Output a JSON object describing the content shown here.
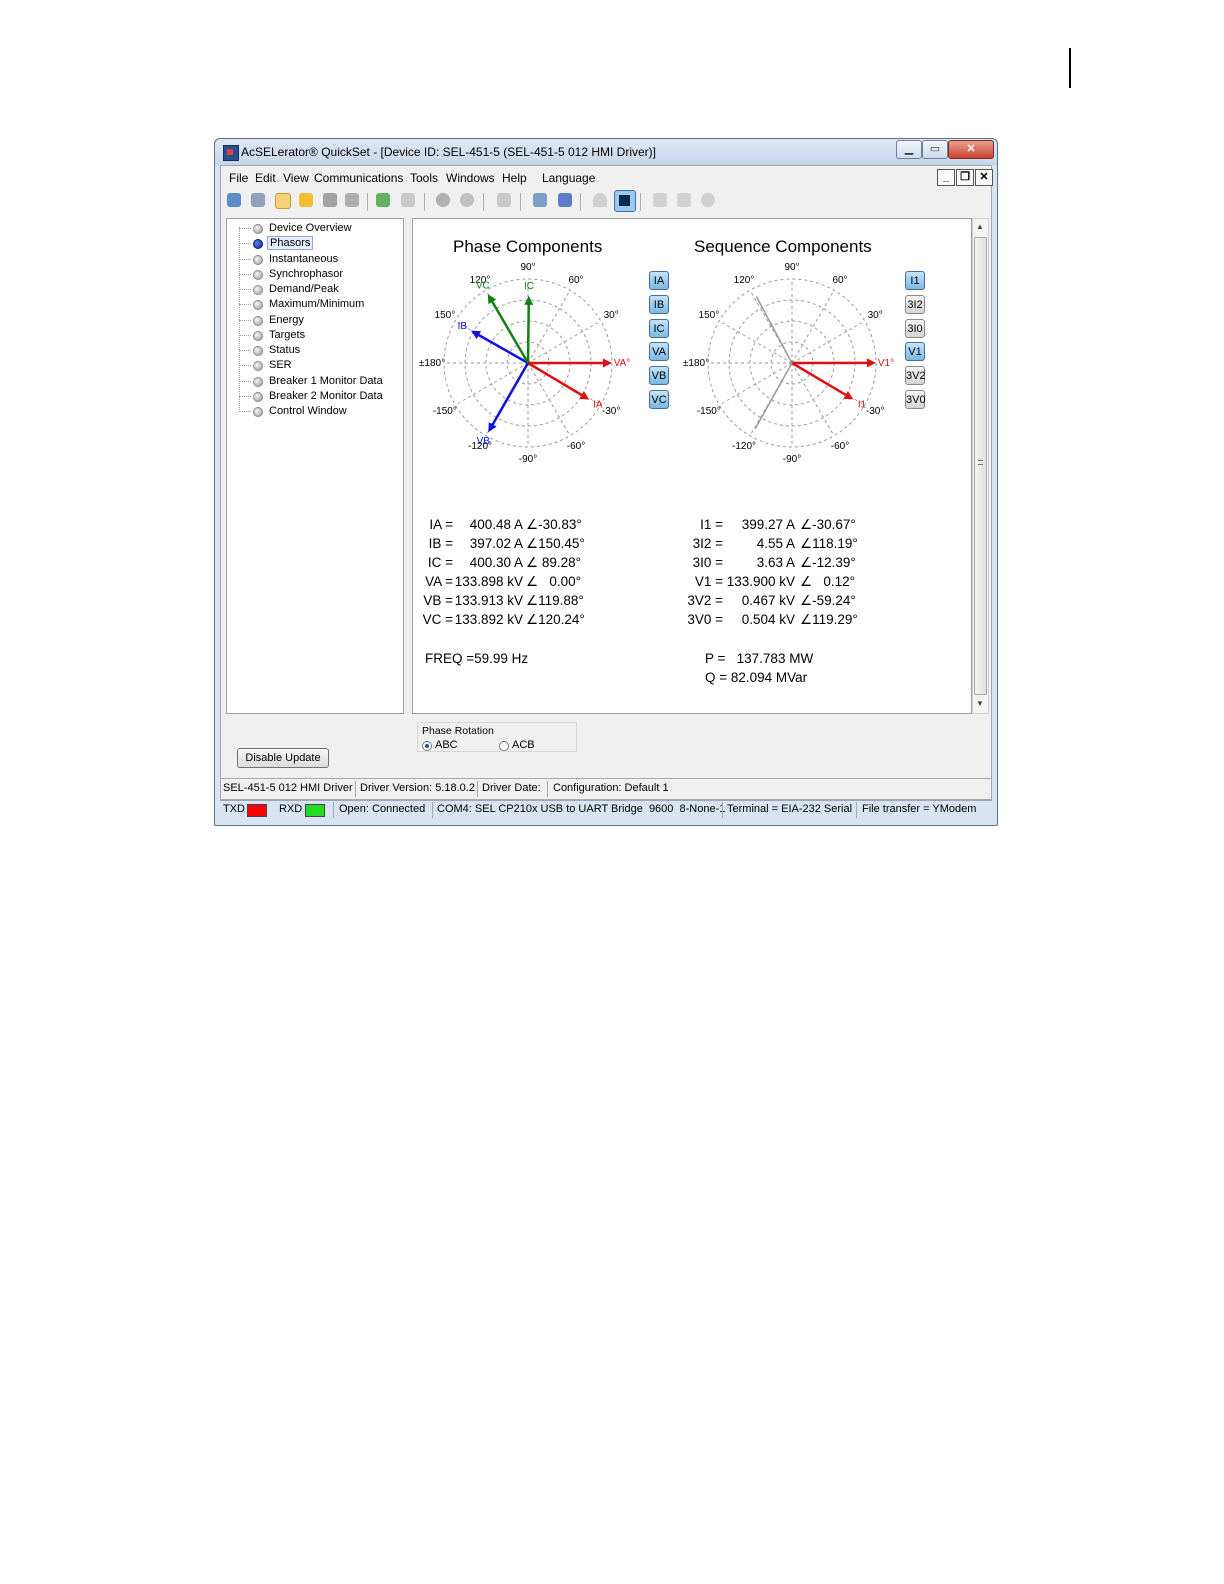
{
  "window": {
    "title": "AcSELerator® QuickSet - [Device ID: SEL-451-5 (SEL-451-5 012 HMI Driver)]"
  },
  "menu": [
    "File",
    "Edit",
    "View",
    "Communications",
    "Tools",
    "Windows",
    "Help",
    "Language"
  ],
  "mdi_controls": {
    "minimize": "_",
    "restore": "❐",
    "close": "✕"
  },
  "tree": [
    {
      "label": "Device Overview",
      "selected": false
    },
    {
      "label": "Phasors",
      "selected": true
    },
    {
      "label": "Instantaneous",
      "selected": false
    },
    {
      "label": "Synchrophasor",
      "selected": false
    },
    {
      "label": "Demand/Peak",
      "selected": false
    },
    {
      "label": "Maximum/Minimum",
      "selected": false
    },
    {
      "label": "Energy",
      "selected": false
    },
    {
      "label": "Targets",
      "selected": false
    },
    {
      "label": "Status",
      "selected": false
    },
    {
      "label": "SER",
      "selected": false
    },
    {
      "label": "Breaker 1 Monitor Data",
      "selected": false
    },
    {
      "label": "Breaker 2 Monitor Data",
      "selected": false
    },
    {
      "label": "Control Window",
      "selected": false
    }
  ],
  "phase": {
    "title": "Phase Components",
    "buttons": [
      {
        "label": "IA",
        "on": true
      },
      {
        "label": "IB",
        "on": true
      },
      {
        "label": "IC",
        "on": true
      },
      {
        "label": "VA",
        "on": true
      },
      {
        "label": "VB",
        "on": true
      },
      {
        "label": "VC",
        "on": true
      }
    ],
    "angle_labels": [
      "90°",
      "60°",
      "30°",
      "-30°",
      "-60°",
      "-90°",
      "-120°",
      "-150°",
      "±180°",
      "150°",
      "120°"
    ],
    "readings": [
      {
        "name": "IA =",
        "mag": "400.48 A",
        "ang": "∠-30.83°"
      },
      {
        "name": "IB =",
        "mag": "397.02 A",
        "ang": "∠150.45°"
      },
      {
        "name": "IC =",
        "mag": "400.30 A",
        "ang": "∠ 89.28°"
      },
      {
        "name": "VA =",
        "mag": "133.898 kV",
        "ang": "∠   0.00°"
      },
      {
        "name": "VB =",
        "mag": "133.913 kV",
        "ang": "∠119.88°"
      },
      {
        "name": "VC =",
        "mag": "133.892 kV",
        "ang": "∠120.24°"
      }
    ],
    "freq": "FREQ =59.99 Hz"
  },
  "sequence": {
    "title": "Sequence Components",
    "buttons": [
      {
        "label": "I1",
        "on": true
      },
      {
        "label": "3I2",
        "on": false
      },
      {
        "label": "3I0",
        "on": false
      },
      {
        "label": "V1",
        "on": true
      },
      {
        "label": "3V2",
        "on": false
      },
      {
        "label": "3V0",
        "on": false
      }
    ],
    "angle_labels": [
      "90°",
      "60°",
      "30°",
      "-30°",
      "-60°",
      "-90°",
      "-120°",
      "-150°",
      "±180°",
      "150°",
      "120°"
    ],
    "readings": [
      {
        "name": "I1 =",
        "mag": "399.27 A",
        "ang": "∠-30.67°"
      },
      {
        "name": "3I2 =",
        "mag": "4.55 A",
        "ang": "∠118.19°"
      },
      {
        "name": "3I0 =",
        "mag": "3.63 A",
        "ang": "∠-12.39°"
      },
      {
        "name": "V1 =",
        "mag": "133.900 kV",
        "ang": "∠   0.12°"
      },
      {
        "name": "3V2 =",
        "mag": "0.467 kV",
        "ang": "∠-59.24°"
      },
      {
        "name": "3V0 =",
        "mag": "0.504 kV",
        "ang": "∠119.29°"
      }
    ],
    "p": "P =   137.783 MW",
    "q": "Q = 82.094 MVar"
  },
  "phasors": {
    "phase": [
      {
        "label": "VA",
        "angle": 0,
        "mag": 1.0,
        "color": "#e01010",
        "label_suffix": "°"
      },
      {
        "label": "IA",
        "angle": -30.83,
        "mag": 0.85,
        "color": "#e01010",
        "label_suffix": ""
      },
      {
        "label": "IB",
        "angle": 150.45,
        "mag": 0.78,
        "color": "#1010e0",
        "label_suffix": ""
      },
      {
        "label": "VB",
        "angle": -119.88,
        "mag": 0.95,
        "color": "#1010e0",
        "label_suffix": ""
      },
      {
        "label": "IC",
        "angle": 89.28,
        "mag": 0.8,
        "color": "#108010",
        "label_suffix": ""
      },
      {
        "label": "VC",
        "angle": 120.24,
        "mag": 0.95,
        "color": "#108010",
        "label_suffix": ""
      }
    ],
    "sequence": [
      {
        "label": "V1",
        "angle": 0.12,
        "mag": 1.0,
        "color": "#e01010",
        "label_suffix": "°"
      },
      {
        "label": "I1",
        "angle": -30.67,
        "mag": 0.85,
        "color": "#e01010",
        "label_suffix": ""
      },
      {
        "label": "",
        "angle": 118.19,
        "mag": 0.98,
        "color": "#9a9a9a",
        "label_suffix": ""
      },
      {
        "label": "",
        "angle": -119.29,
        "mag": 0.98,
        "color": "#9a9a9a",
        "label_suffix": ""
      }
    ]
  },
  "phase_rotation": {
    "title": "Phase Rotation",
    "options": [
      "ABC",
      "ACB"
    ],
    "selected": "ABC"
  },
  "disable_update_label": "Disable Update",
  "status_bar": {
    "driver": "SEL-451-5 012 HMI Driver",
    "driver_version": "Driver Version: 5.18.0.2",
    "driver_date": "Driver Date:",
    "configuration": "Configuration: Default 1",
    "txd": "TXD",
    "rxd": "RXD",
    "txd_color": "#ff0000",
    "rxd_color": "#22dd22",
    "connection": "Open: Connected",
    "port": "COM4: SEL CP210x USB to UART Bridge  9600  8-None-1",
    "terminal": "Terminal = EIA-232 Serial",
    "file_transfer": "File transfer = YModem"
  }
}
